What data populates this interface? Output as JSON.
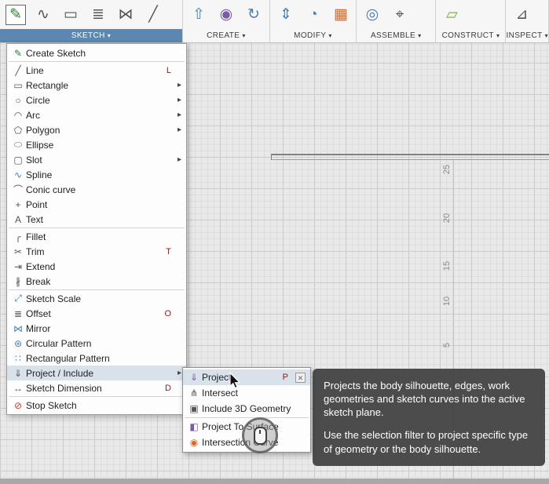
{
  "colors": {
    "accent": "#5b87b0",
    "tooltip-bg": "rgba(64,64,64,0.93)"
  },
  "toolbar": {
    "caret": "▾",
    "groups": [
      {
        "label": "SKETCH",
        "active": true,
        "icons": [
          {
            "name": "create-sketch-icon",
            "glyph": "✎",
            "color": "#2e7d32",
            "boxed": true
          },
          {
            "name": "spline-icon",
            "glyph": "∿",
            "color": "#555555"
          },
          {
            "name": "rectangle-icon",
            "glyph": "▭",
            "color": "#555555"
          },
          {
            "name": "offset-icon",
            "glyph": "≣",
            "color": "#555555"
          },
          {
            "name": "mirror-icon",
            "glyph": "⋈",
            "color": "#555555"
          },
          {
            "name": "trim-icon",
            "glyph": "╱",
            "color": "#555555"
          }
        ]
      },
      {
        "label": "CREATE",
        "icons": [
          {
            "name": "extrude-icon",
            "glyph": "⇧",
            "color": "#4a7fb5"
          },
          {
            "name": "form-icon",
            "glyph": "◉",
            "color": "#7a5ba6"
          },
          {
            "name": "revolve-icon",
            "glyph": "↻",
            "color": "#4a7fb5"
          }
        ]
      },
      {
        "label": "MODIFY",
        "icons": [
          {
            "name": "press-pull-icon",
            "glyph": "⇕",
            "color": "#4a7fb5"
          },
          {
            "name": "fillet-icon",
            "glyph": "◔",
            "color": "#4a7fb5"
          },
          {
            "name": "parameters-icon",
            "glyph": "▦",
            "color": "#d26a2a"
          }
        ]
      },
      {
        "label": "ASSEMBLE",
        "icons": [
          {
            "name": "joint-icon",
            "glyph": "◎",
            "color": "#4a7fb5"
          },
          {
            "name": "interference-icon",
            "glyph": "⌖",
            "color": "#555555"
          }
        ]
      },
      {
        "label": "CONSTRUCT",
        "icons": [
          {
            "name": "construction-plane-icon",
            "glyph": "▱",
            "color": "#7aa646"
          }
        ]
      },
      {
        "label": "INSPECT",
        "icons": [
          {
            "name": "measure-icon",
            "glyph": "⊿",
            "color": "#555555"
          }
        ]
      }
    ]
  },
  "menu": {
    "arrow": "▸",
    "items": [
      {
        "label": "Create Sketch",
        "glyph": "✎",
        "color": "#2e7d32",
        "sep": true
      },
      {
        "label": "Line",
        "glyph": "╱",
        "shortcut": "L"
      },
      {
        "label": "Rectangle",
        "glyph": "▭",
        "submenu": true
      },
      {
        "label": "Circle",
        "glyph": "○",
        "submenu": true
      },
      {
        "label": "Arc",
        "glyph": "◠",
        "submenu": true
      },
      {
        "label": "Polygon",
        "glyph": "⬠",
        "submenu": true
      },
      {
        "label": "Ellipse",
        "glyph": "⬭",
        "color": "#4a7fb5"
      },
      {
        "label": "Slot",
        "glyph": "▢",
        "submenu": true
      },
      {
        "label": "Spline",
        "glyph": "∿",
        "color": "#4a7fb5"
      },
      {
        "label": "Conic curve",
        "glyph": "⌒"
      },
      {
        "label": "Point",
        "glyph": "+"
      },
      {
        "label": "Text",
        "glyph": "A",
        "sep": true
      },
      {
        "label": "Fillet",
        "glyph": "╭"
      },
      {
        "label": "Trim",
        "glyph": "✂",
        "shortcut": "T"
      },
      {
        "label": "Extend",
        "glyph": "⇥"
      },
      {
        "label": "Break",
        "glyph": "∦",
        "sep": true
      },
      {
        "label": "Sketch Scale",
        "glyph": "⤢",
        "color": "#4a7fb5"
      },
      {
        "label": "Offset",
        "glyph": "≣",
        "shortcut": "O"
      },
      {
        "label": "Mirror",
        "glyph": "⋈",
        "color": "#4a7fb5"
      },
      {
        "label": "Circular Pattern",
        "glyph": "⊛",
        "color": "#4a7fb5"
      },
      {
        "label": "Rectangular Pattern",
        "glyph": "∷",
        "color": "#4a7fb5"
      },
      {
        "label": "Project / Include",
        "glyph": "⇓",
        "submenu": true,
        "highlight": true
      },
      {
        "label": "Sketch Dimension",
        "glyph": "↔",
        "shortcut": "D",
        "sep": true
      },
      {
        "label": "Stop Sketch",
        "glyph": "⊘",
        "color": "#c0392b"
      }
    ]
  },
  "submenu": {
    "close_label": "✕",
    "items": [
      {
        "label": "Project",
        "glyph": "⇓",
        "color": "#7a5ba6",
        "shortcut": "P",
        "close": true,
        "highlight": true
      },
      {
        "label": "Intersect",
        "glyph": "⋔"
      },
      {
        "label": "Include 3D Geometry",
        "glyph": "▣",
        "sep": true
      },
      {
        "label": "Project To Surface",
        "glyph": "◧",
        "color": "#7a5ba6"
      },
      {
        "label": "Intersection Curve",
        "glyph": "◉",
        "color": "#d26a2a"
      }
    ]
  },
  "tooltip": {
    "paragraphs": [
      "Projects the body silhouette, edges, work geometries and sketch curves into the active sketch plane.",
      "Use the selection filter to project specific type of geometry or the body silhouette."
    ]
  },
  "canvas": {
    "ruler_labels": [
      "25",
      "20",
      "15",
      "10",
      "5"
    ]
  }
}
